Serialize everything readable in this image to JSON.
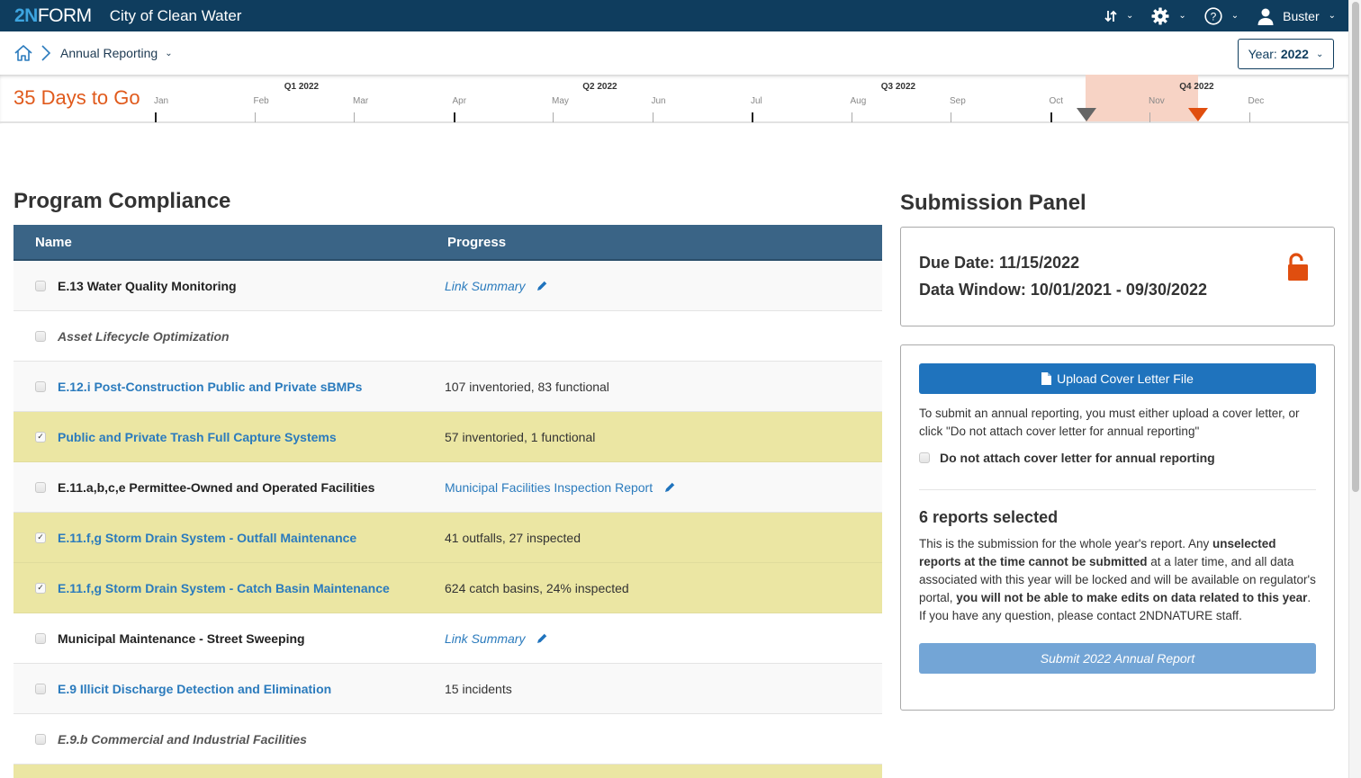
{
  "header": {
    "logo_prefix": "2N",
    "logo_text": "FORM",
    "app_title": "City of Clean Water",
    "icons": [
      "sort-icon",
      "gear-icon",
      "help-icon",
      "user-icon"
    ],
    "user_name": "Buster"
  },
  "breadcrumb": {
    "home_icon": "home-icon",
    "current": "Annual Reporting"
  },
  "year_select": {
    "label": "Year:",
    "value": "2022"
  },
  "timeline": {
    "countdown": "35 Days to Go",
    "months": [
      "Jan",
      "Feb",
      "Mar",
      "Apr",
      "May",
      "Jun",
      "Jul",
      "Aug",
      "Sep",
      "Oct",
      "Nov",
      "Dec"
    ],
    "quarters": [
      "Q1 2022",
      "Q2 2022",
      "Q3 2022",
      "Q4 2022"
    ],
    "highlight_color": "#f7d3c5",
    "markers": [
      {
        "name": "current-date-marker",
        "color": "#666666"
      },
      {
        "name": "due-date-marker",
        "color": "#e04e0f"
      }
    ]
  },
  "program_compliance": {
    "title": "Program Compliance",
    "columns": [
      "Name",
      "Progress"
    ],
    "rows": [
      {
        "name": "E.13 Water Quality Monitoring",
        "style": "plain",
        "checked": false,
        "selected": false,
        "progress": "Link Summary",
        "progress_type": "link-italic",
        "editable": true
      },
      {
        "name": "Asset Lifecycle Optimization",
        "style": "italic",
        "checked": false,
        "selected": false,
        "progress": "",
        "progress_type": "none",
        "editable": false
      },
      {
        "name": "E.12.i Post-Construction Public and Private sBMPs",
        "style": "link",
        "checked": false,
        "selected": false,
        "progress": "107 inventoried, 83 functional",
        "progress_type": "text",
        "editable": false
      },
      {
        "name": "Public and Private Trash Full Capture Systems",
        "style": "link",
        "checked": true,
        "selected": true,
        "progress": "57 inventoried, 1 functional",
        "progress_type": "text",
        "editable": false
      },
      {
        "name": "E.11.a,b,c,e Permittee-Owned and Operated Facilities",
        "style": "plain",
        "checked": false,
        "selected": false,
        "progress": "Municipal Facilities Inspection Report",
        "progress_type": "link",
        "editable": true
      },
      {
        "name": "E.11.f,g Storm Drain System - Outfall Maintenance",
        "style": "link",
        "checked": true,
        "selected": true,
        "progress": "41 outfalls, 27 inspected",
        "progress_type": "text",
        "editable": false
      },
      {
        "name": "E.11.f,g Storm Drain System - Catch Basin Maintenance",
        "style": "link",
        "checked": true,
        "selected": true,
        "progress": "624 catch basins, 24% inspected",
        "progress_type": "text",
        "editable": false
      },
      {
        "name": "Municipal Maintenance - Street Sweeping",
        "style": "plain",
        "checked": false,
        "selected": false,
        "progress": "Link Summary",
        "progress_type": "link-italic",
        "editable": true
      },
      {
        "name": "E.9 Illicit Discharge Detection and Elimination",
        "style": "link",
        "checked": false,
        "selected": false,
        "progress": "15 incidents",
        "progress_type": "text",
        "editable": false
      },
      {
        "name": "E.9.b Commercial and Industrial Facilities",
        "style": "italic",
        "checked": false,
        "selected": false,
        "progress": "",
        "progress_type": "none",
        "editable": false
      },
      {
        "name": "",
        "style": "plain",
        "checked": false,
        "selected": true,
        "progress": "",
        "progress_type": "none",
        "editable": false,
        "partial": true
      }
    ]
  },
  "submission_panel": {
    "title": "Submission Panel",
    "due_date": "Due Date: 11/15/2022",
    "data_window": "Data Window: 10/01/2021 - 09/30/2022",
    "lock_icon": "unlocked-icon",
    "lock_color": "#e04e0f",
    "upload_button": "Upload Cover Letter File",
    "instructions": "To submit an annual reporting, you must either upload a cover letter, or click \"Do not attach cover letter for annual reporting\"",
    "no_cover_label": "Do not attach cover letter for annual reporting",
    "no_cover_checked": false,
    "selected_count": "6 reports selected",
    "warning_parts": [
      {
        "text": "This is the submission for the whole year's report. Any ",
        "bold": false
      },
      {
        "text": "unselected reports at the time cannot be submitted",
        "bold": true
      },
      {
        "text": " at a later time, and all data associated with this year will be locked and will be available on regulator's portal, ",
        "bold": false
      },
      {
        "text": "you will not be able to make edits on data related to this year",
        "bold": true
      },
      {
        "text": ". If you have any question, please contact 2NDNATURE staff.",
        "bold": false
      }
    ],
    "submit_button": "Submit 2022 Annual Report",
    "submit_enabled": false
  },
  "colors": {
    "nav_bg": "#0f3d5e",
    "table_header_bg": "#3a6486",
    "selected_row_bg": "#ebe6a3",
    "link": "#2b7bbd",
    "accent_orange": "#e05a1c",
    "primary_button": "#1f73bd",
    "disabled_button": "#73a5d6"
  }
}
